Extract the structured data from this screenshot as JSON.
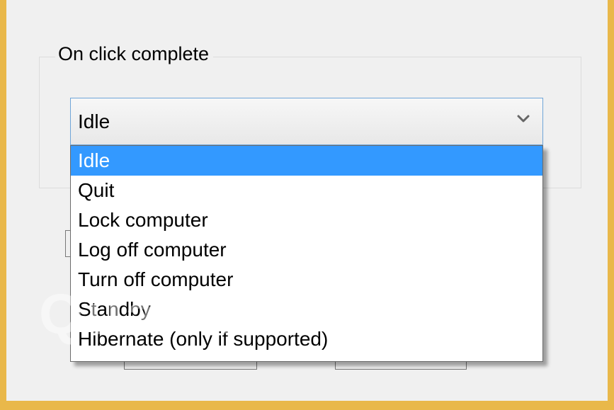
{
  "groupbox": {
    "label": "On click complete"
  },
  "combo": {
    "selected_value": "Idle",
    "arrow_icon": "chevron-down-icon"
  },
  "dropdown": {
    "items": [
      {
        "label": "Idle",
        "selected": true
      },
      {
        "label": "Quit",
        "selected": false
      },
      {
        "label": "Lock computer",
        "selected": false
      },
      {
        "label": "Log off computer",
        "selected": false
      },
      {
        "label": "Turn off computer",
        "selected": false
      },
      {
        "label": "Standby",
        "selected": false
      },
      {
        "label": "Hibernate (only if supported)",
        "selected": false
      }
    ]
  },
  "watermark": {
    "text": "Quantrimang"
  },
  "colors": {
    "outer_border": "#e9b84a",
    "window_bg": "#f0f0f0",
    "selection": "#3399ff",
    "combo_border": "#6fa5d8"
  }
}
